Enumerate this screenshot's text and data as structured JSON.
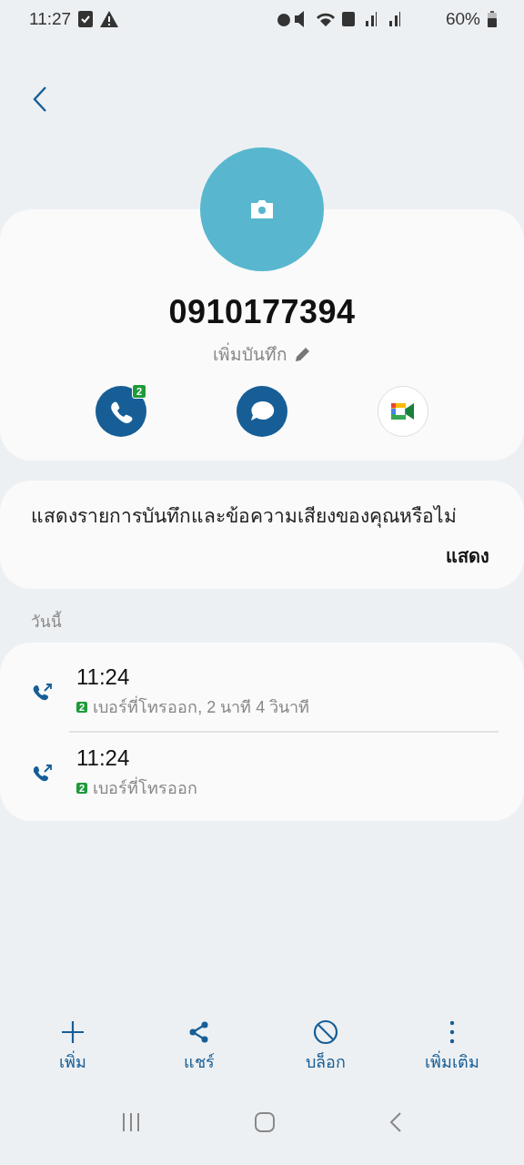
{
  "status_bar": {
    "time": "11:27",
    "battery": "60%"
  },
  "contact": {
    "number": "0910177394",
    "note": "เพิ่มบันทึก"
  },
  "actions": [
    {
      "kind": "call",
      "badge": "2"
    },
    {
      "kind": "message"
    },
    {
      "kind": "video"
    }
  ],
  "notice": {
    "text": "แสดงรายการบันทึกและข้อความเสียงของคุณหรือไม่",
    "button": "แสดง"
  },
  "section": "วันนี้",
  "calls": [
    {
      "time": "11:24",
      "sim": "2",
      "detail": "เบอร์ที่โทรออก, 2 นาที 4 วินาที"
    },
    {
      "time": "11:24",
      "sim": "2",
      "detail": "เบอร์ที่โทรออก"
    }
  ],
  "toolbar": [
    {
      "kind": "add",
      "label": "เพิ่ม"
    },
    {
      "kind": "share",
      "label": "แชร์"
    },
    {
      "kind": "block",
      "label": "บล็อก"
    },
    {
      "kind": "more",
      "label": "เพิ่มเติม"
    }
  ]
}
